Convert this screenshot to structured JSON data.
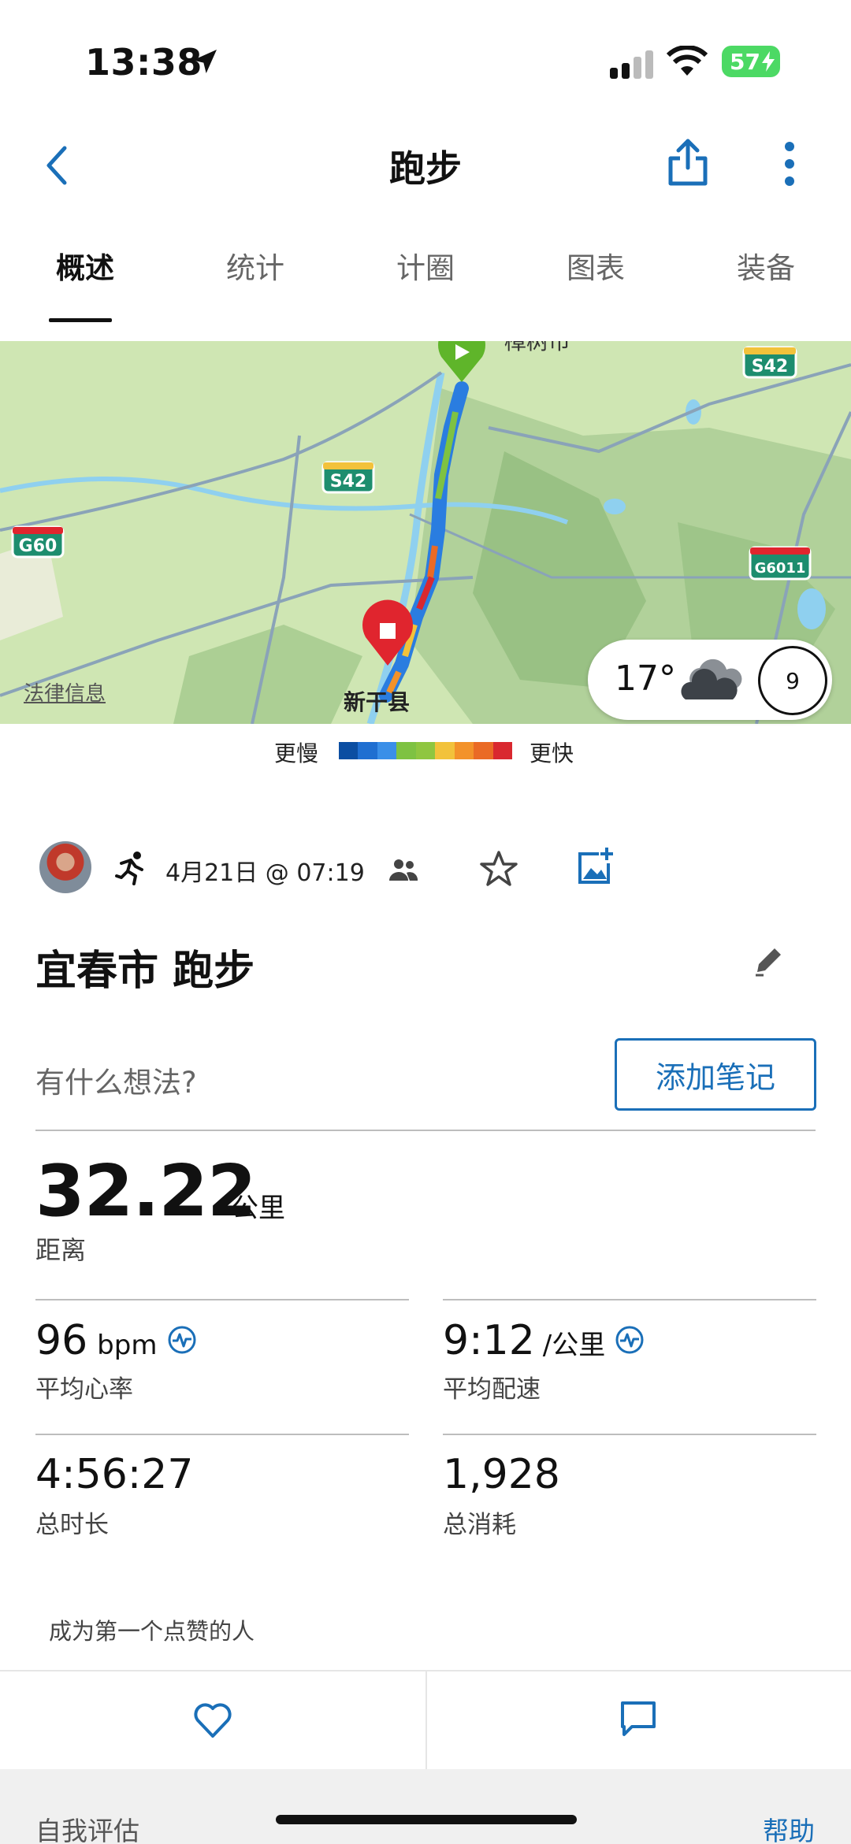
{
  "status": {
    "time": "13:38",
    "battery": "57"
  },
  "header": {
    "title": "跑步"
  },
  "tabs": [
    "概述",
    "统计",
    "计圈",
    "图表",
    "装备"
  ],
  "map": {
    "legal": "法律信息",
    "city_label": "新干县",
    "top_label": "樟树市",
    "road_labels": [
      "S42",
      "S42",
      "G60",
      "G6011"
    ],
    "weather_temp": "17°",
    "wind": "9"
  },
  "legend": {
    "slower": "更慢",
    "faster": "更快",
    "colors": [
      "#0b4ea2",
      "#1f6fd1",
      "#3a8fe8",
      "#7ec242",
      "#8fc640",
      "#f2c23b",
      "#f3922a",
      "#ea6a25",
      "#d9282f"
    ]
  },
  "activity": {
    "date": "4月21日 @ 07:19",
    "title": "宜春市 跑步",
    "note_placeholder": "有什么想法?",
    "add_note": "添加笔记"
  },
  "stats": {
    "distance": {
      "value": "32.22",
      "unit": "公里",
      "label": "距离"
    },
    "heart_rate": {
      "value": "96",
      "unit": "bpm",
      "label": "平均心率"
    },
    "pace": {
      "value": "9:12",
      "unit": "/公里",
      "label": "平均配速"
    },
    "duration": {
      "value": "4:56:27",
      "label": "总时长"
    },
    "calories": {
      "value": "1,928",
      "label": "总消耗"
    }
  },
  "social": {
    "like_prompt": "成为第一个点赞的人"
  },
  "footer": {
    "self_eval": "自我评估",
    "help": "帮助"
  },
  "colors": {
    "accent": "#1a6fb8",
    "map_bg": "#cfe6b3"
  }
}
